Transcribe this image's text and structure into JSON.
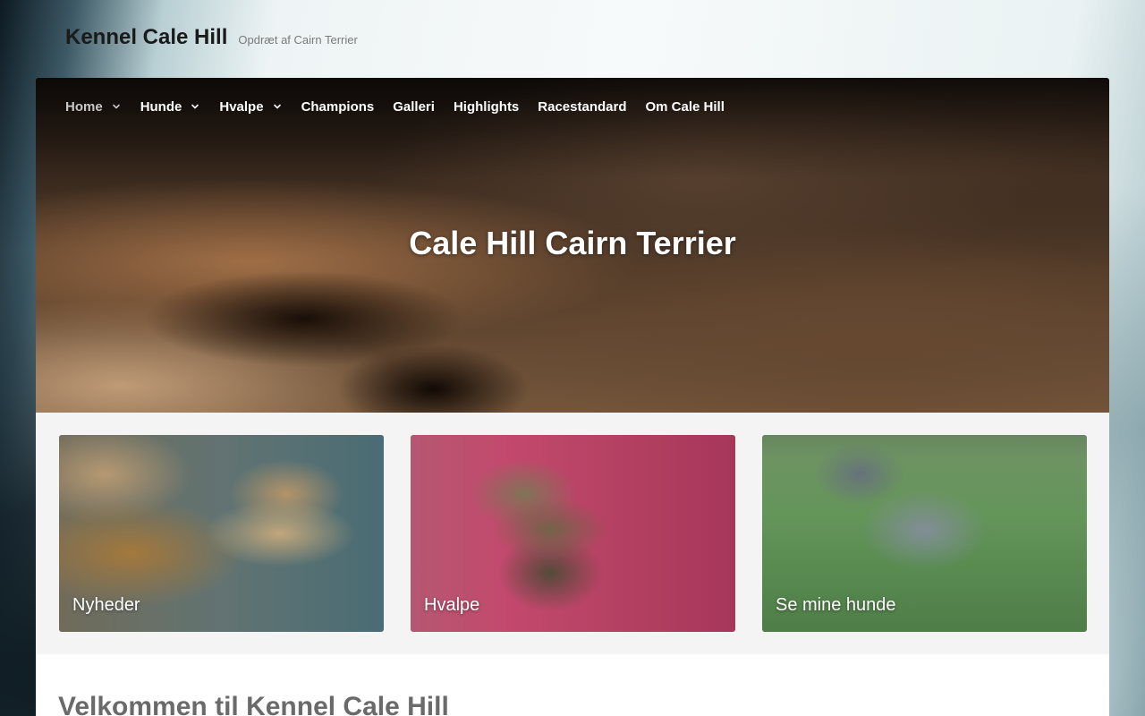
{
  "site": {
    "title": "Kennel Cale Hill",
    "tagline": "Opdræt af Cairn Terrier"
  },
  "nav": {
    "items": [
      {
        "label": "Home",
        "has_dropdown": true,
        "active": true
      },
      {
        "label": "Hunde",
        "has_dropdown": true
      },
      {
        "label": "Hvalpe",
        "has_dropdown": true
      },
      {
        "label": "Champions",
        "has_dropdown": false
      },
      {
        "label": "Galleri",
        "has_dropdown": false
      },
      {
        "label": "Highlights",
        "has_dropdown": false
      },
      {
        "label": "Racestandard",
        "has_dropdown": false
      },
      {
        "label": "Om Cale Hill",
        "has_dropdown": false
      }
    ]
  },
  "hero": {
    "title": "Cale Hill Cairn Terrier"
  },
  "cards": [
    {
      "label": "Nyheder"
    },
    {
      "label": "Hvalpe"
    },
    {
      "label": "Se mine hunde"
    }
  ],
  "content": {
    "heading": "Velkommen til Kennel Cale Hill"
  },
  "colors": {
    "nav_text": "#ffffff",
    "nav_active": "#c8c8c8",
    "band_background": "#f5f4f4"
  }
}
